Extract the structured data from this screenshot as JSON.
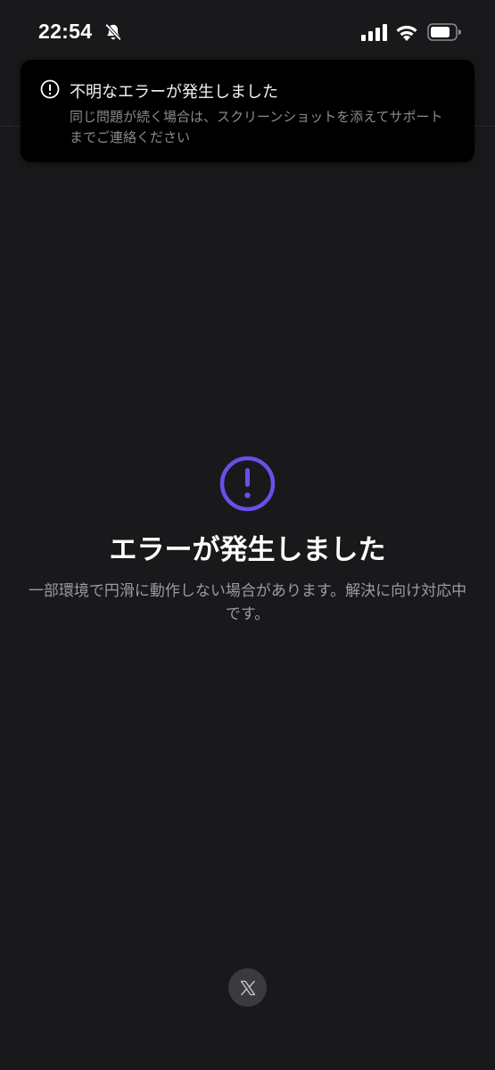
{
  "status_bar": {
    "time": "22:54",
    "icons": [
      "bell-slash-icon",
      "cellular-signal-icon",
      "wifi-icon",
      "battery-icon"
    ]
  },
  "toast": {
    "icon": "alert-circle-icon",
    "title": "不明なエラーが発生しました",
    "message": "同じ問題が続く場合は、スクリーンショットを添えてサポートまでご連絡ください"
  },
  "error": {
    "icon": "exclamation-circle-icon",
    "icon_color": "#6a4fe8",
    "title": "エラーが発生しました",
    "message": "一部環境で円滑に動作しない場合があります。解決に向け対応中です。"
  },
  "footer": {
    "icon": "x-logo-icon"
  },
  "colors": {
    "background": "#19191c",
    "toast_background": "#000000",
    "accent": "#6a4fe8"
  }
}
